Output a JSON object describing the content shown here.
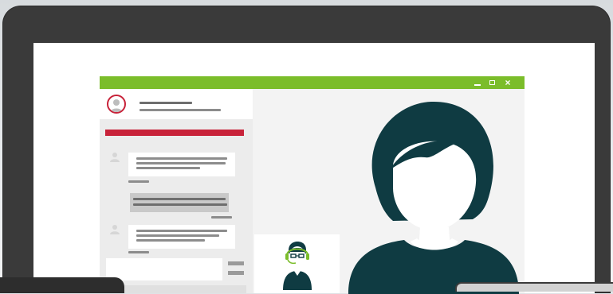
{
  "window": {
    "controls": {
      "minimize": "_",
      "maximize": "□",
      "close": "×"
    }
  },
  "colors": {
    "titlebar": "#7bbd2a",
    "alert": "#c8233a",
    "person": "#0f3b42",
    "headset": "#7bbd2a",
    "bezel": "#3a3a3a"
  },
  "icons": {
    "avatar": "user-avatar-icon",
    "message_user": "user-silhouette-icon",
    "agent": "support-agent-headset-icon",
    "remote_person": "person-silhouette-icon"
  }
}
